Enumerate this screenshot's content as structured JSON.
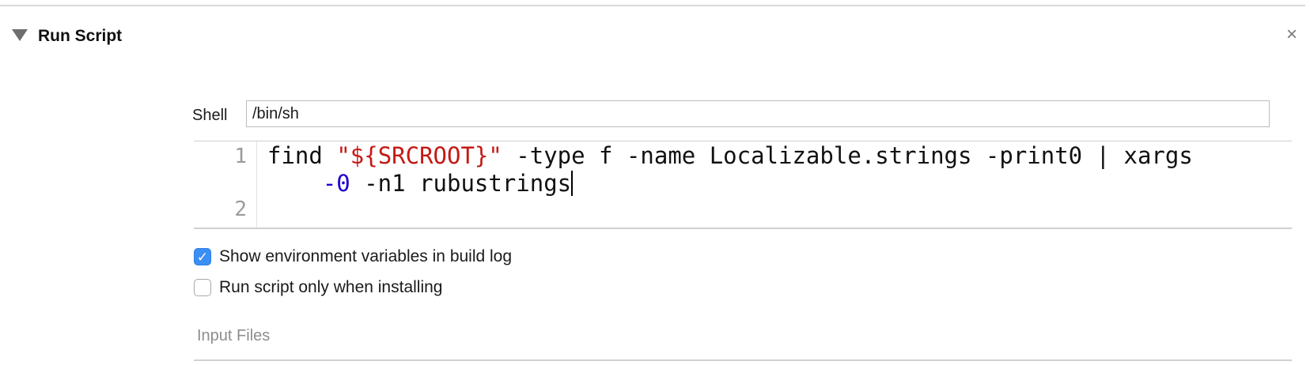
{
  "phase": {
    "title": "Run Script",
    "close_glyph": "×",
    "disclosure_icon": "triangle-down-icon",
    "close_icon": "close-icon"
  },
  "shell": {
    "label": "Shell",
    "value": "/bin/sh"
  },
  "editor": {
    "line_numbers": [
      "1",
      "2"
    ],
    "line1": {
      "t1": "find ",
      "t2": "\"${SRCROOT}\"",
      "t3": " -type f -name Localizable.strings -print0 | xargs"
    },
    "line1_wrap": {
      "t1": "    ",
      "t2": "-0",
      "t3": " -n1 rubustrings"
    },
    "colors": {
      "string": "#c41a16",
      "number": "#1c00cf"
    }
  },
  "options": {
    "show_env": {
      "label": "Show environment variables in build log",
      "checked": true
    },
    "run_only_installing": {
      "label": "Run script only when installing",
      "checked": false
    }
  },
  "input_files": {
    "label": "Input Files"
  },
  "colors": {
    "accent": "#3b8ef3"
  }
}
